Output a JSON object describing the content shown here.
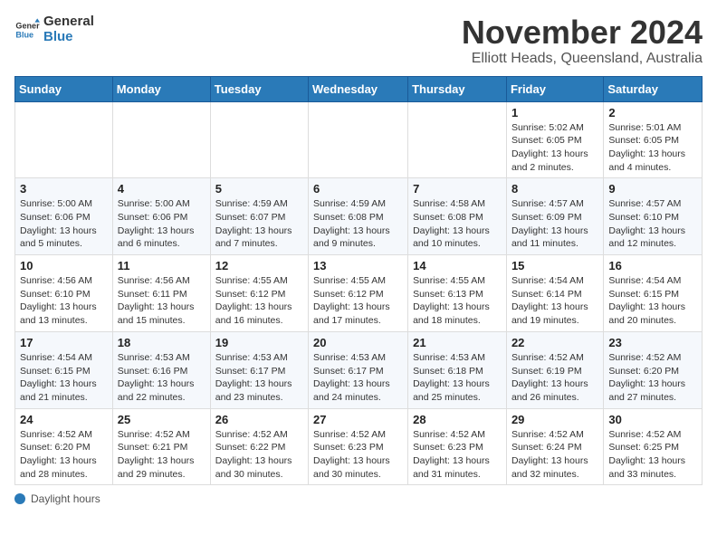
{
  "header": {
    "logo_general": "General",
    "logo_blue": "Blue",
    "month_title": "November 2024",
    "location": "Elliott Heads, Queensland, Australia"
  },
  "days_of_week": [
    "Sunday",
    "Monday",
    "Tuesday",
    "Wednesday",
    "Thursday",
    "Friday",
    "Saturday"
  ],
  "weeks": [
    [
      {
        "day": "",
        "info": ""
      },
      {
        "day": "",
        "info": ""
      },
      {
        "day": "",
        "info": ""
      },
      {
        "day": "",
        "info": ""
      },
      {
        "day": "",
        "info": ""
      },
      {
        "day": "1",
        "info": "Sunrise: 5:02 AM\nSunset: 6:05 PM\nDaylight: 13 hours and 2 minutes."
      },
      {
        "day": "2",
        "info": "Sunrise: 5:01 AM\nSunset: 6:05 PM\nDaylight: 13 hours and 4 minutes."
      }
    ],
    [
      {
        "day": "3",
        "info": "Sunrise: 5:00 AM\nSunset: 6:06 PM\nDaylight: 13 hours and 5 minutes."
      },
      {
        "day": "4",
        "info": "Sunrise: 5:00 AM\nSunset: 6:06 PM\nDaylight: 13 hours and 6 minutes."
      },
      {
        "day": "5",
        "info": "Sunrise: 4:59 AM\nSunset: 6:07 PM\nDaylight: 13 hours and 7 minutes."
      },
      {
        "day": "6",
        "info": "Sunrise: 4:59 AM\nSunset: 6:08 PM\nDaylight: 13 hours and 9 minutes."
      },
      {
        "day": "7",
        "info": "Sunrise: 4:58 AM\nSunset: 6:08 PM\nDaylight: 13 hours and 10 minutes."
      },
      {
        "day": "8",
        "info": "Sunrise: 4:57 AM\nSunset: 6:09 PM\nDaylight: 13 hours and 11 minutes."
      },
      {
        "day": "9",
        "info": "Sunrise: 4:57 AM\nSunset: 6:10 PM\nDaylight: 13 hours and 12 minutes."
      }
    ],
    [
      {
        "day": "10",
        "info": "Sunrise: 4:56 AM\nSunset: 6:10 PM\nDaylight: 13 hours and 13 minutes."
      },
      {
        "day": "11",
        "info": "Sunrise: 4:56 AM\nSunset: 6:11 PM\nDaylight: 13 hours and 15 minutes."
      },
      {
        "day": "12",
        "info": "Sunrise: 4:55 AM\nSunset: 6:12 PM\nDaylight: 13 hours and 16 minutes."
      },
      {
        "day": "13",
        "info": "Sunrise: 4:55 AM\nSunset: 6:12 PM\nDaylight: 13 hours and 17 minutes."
      },
      {
        "day": "14",
        "info": "Sunrise: 4:55 AM\nSunset: 6:13 PM\nDaylight: 13 hours and 18 minutes."
      },
      {
        "day": "15",
        "info": "Sunrise: 4:54 AM\nSunset: 6:14 PM\nDaylight: 13 hours and 19 minutes."
      },
      {
        "day": "16",
        "info": "Sunrise: 4:54 AM\nSunset: 6:15 PM\nDaylight: 13 hours and 20 minutes."
      }
    ],
    [
      {
        "day": "17",
        "info": "Sunrise: 4:54 AM\nSunset: 6:15 PM\nDaylight: 13 hours and 21 minutes."
      },
      {
        "day": "18",
        "info": "Sunrise: 4:53 AM\nSunset: 6:16 PM\nDaylight: 13 hours and 22 minutes."
      },
      {
        "day": "19",
        "info": "Sunrise: 4:53 AM\nSunset: 6:17 PM\nDaylight: 13 hours and 23 minutes."
      },
      {
        "day": "20",
        "info": "Sunrise: 4:53 AM\nSunset: 6:17 PM\nDaylight: 13 hours and 24 minutes."
      },
      {
        "day": "21",
        "info": "Sunrise: 4:53 AM\nSunset: 6:18 PM\nDaylight: 13 hours and 25 minutes."
      },
      {
        "day": "22",
        "info": "Sunrise: 4:52 AM\nSunset: 6:19 PM\nDaylight: 13 hours and 26 minutes."
      },
      {
        "day": "23",
        "info": "Sunrise: 4:52 AM\nSunset: 6:20 PM\nDaylight: 13 hours and 27 minutes."
      }
    ],
    [
      {
        "day": "24",
        "info": "Sunrise: 4:52 AM\nSunset: 6:20 PM\nDaylight: 13 hours and 28 minutes."
      },
      {
        "day": "25",
        "info": "Sunrise: 4:52 AM\nSunset: 6:21 PM\nDaylight: 13 hours and 29 minutes."
      },
      {
        "day": "26",
        "info": "Sunrise: 4:52 AM\nSunset: 6:22 PM\nDaylight: 13 hours and 30 minutes."
      },
      {
        "day": "27",
        "info": "Sunrise: 4:52 AM\nSunset: 6:23 PM\nDaylight: 13 hours and 30 minutes."
      },
      {
        "day": "28",
        "info": "Sunrise: 4:52 AM\nSunset: 6:23 PM\nDaylight: 13 hours and 31 minutes."
      },
      {
        "day": "29",
        "info": "Sunrise: 4:52 AM\nSunset: 6:24 PM\nDaylight: 13 hours and 32 minutes."
      },
      {
        "day": "30",
        "info": "Sunrise: 4:52 AM\nSunset: 6:25 PM\nDaylight: 13 hours and 33 minutes."
      }
    ]
  ],
  "legend": {
    "label": "Daylight hours"
  }
}
